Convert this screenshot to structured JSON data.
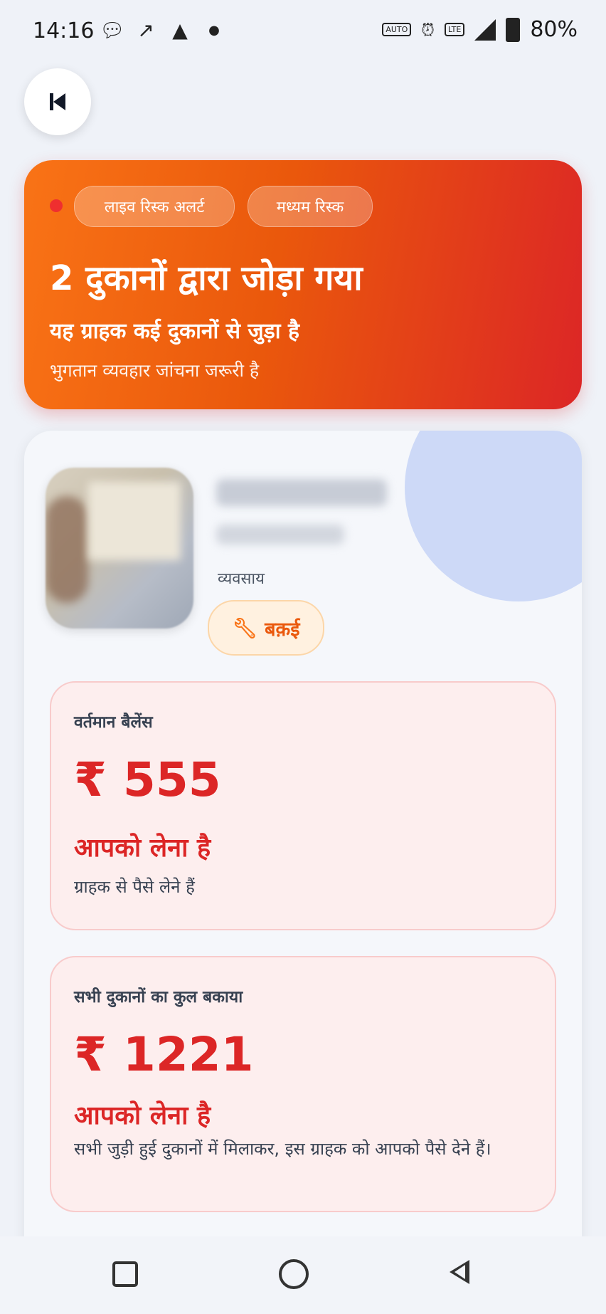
{
  "status_bar": {
    "time": "14:16",
    "battery": "80%",
    "left_icons": [
      "chat-icon",
      "missed-call-icon",
      "nav-arrow-icon",
      "dot-icon"
    ],
    "right_icons": [
      "auto-hz-icon",
      "alarm-icon",
      "volte-icon",
      "signal-icon",
      "battery-icon"
    ],
    "auto_badge": "AUTO",
    "volte_badge": "LTE"
  },
  "alert": {
    "live_label": "लाइव रिस्क अलर्ट",
    "risk_label": "मध्यम रिस्क",
    "title": "2 दुकानों द्वारा जोड़ा गया",
    "subtitle": "यह ग्राहक कई दुकानों से जुड़ा है",
    "note": "भुगतान व्यवहार जांचना जरूरी है",
    "gradient_colors": [
      "#f97316",
      "#dc2626"
    ]
  },
  "customer": {
    "business_label": "व्यवसाय",
    "business_tag": "बक़ई"
  },
  "balance": {
    "label": "वर्तमान बैलेंस",
    "amount": "₹ 555",
    "status": "आपको लेना है",
    "description": "ग्राहक से पैसे लेने हैं"
  },
  "total_due": {
    "label": "सभी दुकानों का कुल बकाया",
    "amount": "₹ 1221",
    "status": "आपको लेना है",
    "description": "सभी जुड़ी हुई दुकानों में मिलाकर, इस ग्राहक को आपको पैसे देने हैं।"
  },
  "colors": {
    "accent_red": "#dc2626",
    "accent_orange": "#ea580c"
  }
}
